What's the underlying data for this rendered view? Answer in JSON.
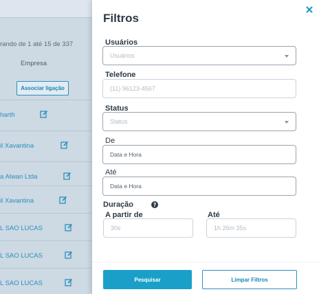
{
  "background": {
    "showing_text": "rando de 1 até 15 de 337",
    "column_header": "Empresa",
    "associate_button": "Associar ligação",
    "rows": [
      {
        "text": "harth"
      },
      {
        "text": "il Xavantina"
      },
      {
        "text": "a Alwan Ltda"
      },
      {
        "text": "il Xavantina"
      },
      {
        "text": "L SAO LUCAS"
      },
      {
        "text": "L SAO LUCAS"
      },
      {
        "text": "L SAO LUCAS"
      }
    ]
  },
  "panel": {
    "title": "Filtros",
    "usuarios_label": "Usuários",
    "usuarios_placeholder": "Usuários",
    "telefone_label": "Telefone",
    "telefone_placeholder": "(11) 96123-4567",
    "status_label": "Status",
    "status_placeholder": "Status",
    "de_label": "De",
    "de_value": "Data e Hora",
    "ate_label": "Até",
    "ate_value": "Data e Hora",
    "duracao_label": "Duração",
    "a_partir_de_label": "A partir de",
    "a_partir_de_placeholder": "30s",
    "ate_duracao_label": "Até",
    "ate_duracao_placeholder": "1h 26m 35s",
    "search_button": "Pesquisar",
    "clear_button": "Limpar Filtros"
  },
  "colors": {
    "accent": "#1aa0c8",
    "link": "#2a8fbe",
    "overlay": "#cdd9e3"
  },
  "icons": [
    "edit-icon",
    "close-icon",
    "help-icon",
    "chevron-down-icon"
  ]
}
